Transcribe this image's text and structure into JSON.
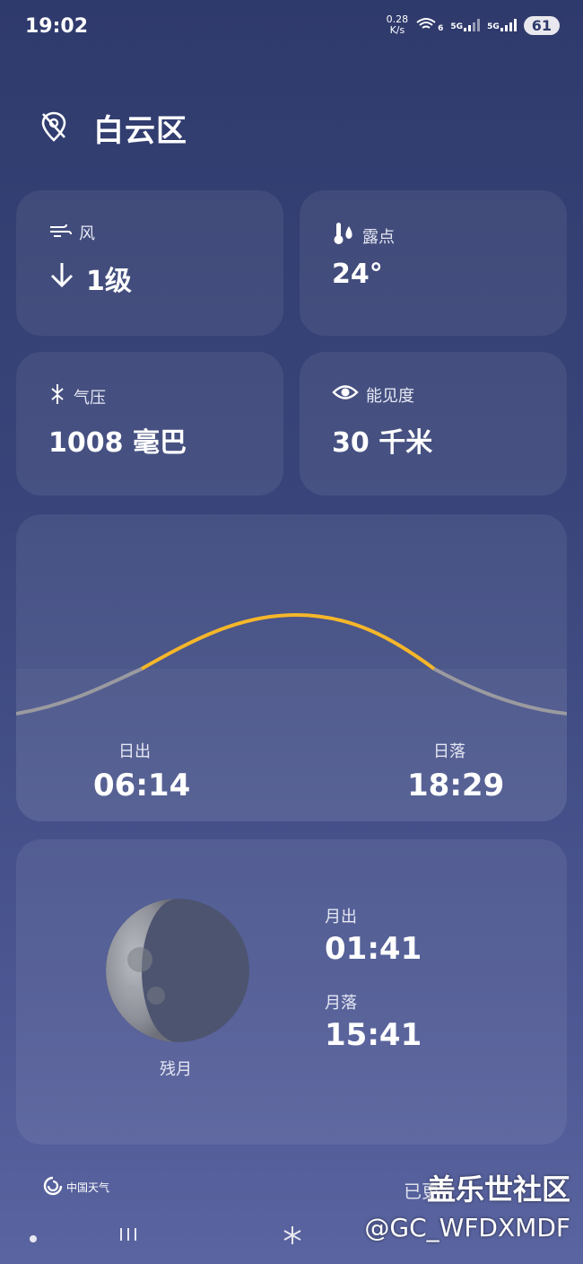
{
  "status_bar": {
    "time": "19:02",
    "net_speed_value": "0.28",
    "net_speed_unit": "K/s",
    "wifi_badge": "6",
    "sim1": "5G",
    "sim2": "5G",
    "battery": "61"
  },
  "location": {
    "name": "白云区",
    "icon": "location-off-icon"
  },
  "cards": {
    "wind": {
      "label": "风",
      "value": "1级",
      "icon": "wind-icon",
      "arrow_icon": "arrow-down-icon"
    },
    "dew_point": {
      "label": "露点",
      "value": "24°",
      "icon": "dew-point-icon"
    },
    "pressure": {
      "label": "气压",
      "value": "1008 毫巴",
      "icon": "pressure-icon"
    },
    "visibility": {
      "label": "能见度",
      "value": "30 千米",
      "icon": "eye-icon"
    }
  },
  "sun": {
    "sunrise_label": "日出",
    "sunrise_time": "06:14",
    "sunset_label": "日落",
    "sunset_time": "18:29",
    "day_color": "#f5b62a",
    "night_color": "#9a9aa0"
  },
  "moon": {
    "phase": "残月",
    "rise_label": "月出",
    "rise_time": "01:41",
    "set_label": "月落",
    "set_time": "15:41"
  },
  "footer": {
    "brand": "中国天气",
    "update_text": "已更"
  },
  "watermark": {
    "title": "盖乐世社区",
    "user": "@GC_WFDXMDF"
  },
  "colors": {
    "background_top": "#2f3a6c",
    "background_bottom": "#5a64a0",
    "card": "rgba(255,255,255,0.07)"
  }
}
